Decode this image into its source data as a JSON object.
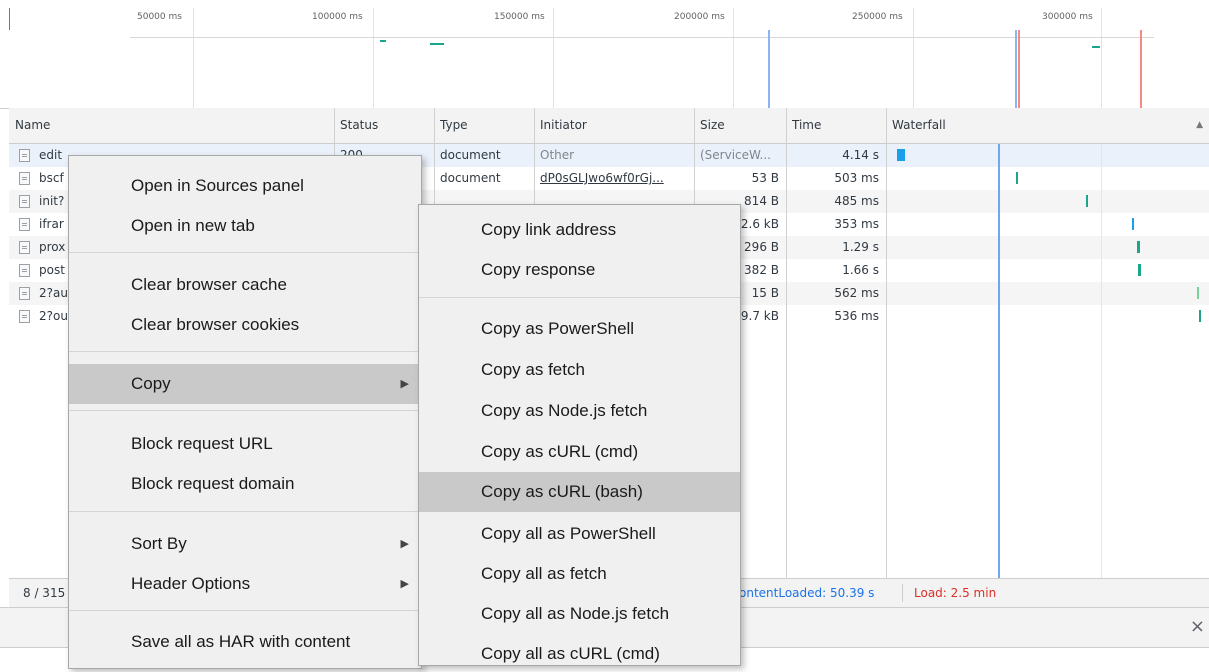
{
  "overview": {
    "ticks": [
      "50000 ms",
      "100000 ms",
      "150000 ms",
      "200000 ms",
      "250000 ms",
      "300000 ms"
    ]
  },
  "columns": {
    "name": "Name",
    "status": "Status",
    "type": "Type",
    "initiator": "Initiator",
    "size": "Size",
    "time": "Time",
    "waterfall": "Waterfall"
  },
  "rows": [
    {
      "name": "edit",
      "status": "200",
      "type": "document",
      "initiator": "Other",
      "size": "(ServiceW...",
      "time": "4.14 s"
    },
    {
      "name": "bscf",
      "status": "",
      "type": "document",
      "initiator": "dP0sGLJwo6wf0rGj...",
      "size": "53 B",
      "time": "503 ms"
    },
    {
      "name": "init?",
      "status": "",
      "type": "",
      "initiator": "",
      "size": "814 B",
      "time": "485 ms"
    },
    {
      "name": "ifrar",
      "status": "",
      "type": "",
      "initiator": "",
      "size": "2.6 kB",
      "time": "353 ms"
    },
    {
      "name": "prox",
      "status": "",
      "type": "",
      "initiator": "",
      "size": "296 B",
      "time": "1.29 s"
    },
    {
      "name": "post",
      "status": "",
      "type": "",
      "initiator": "",
      "size": "382 B",
      "time": "1.66 s"
    },
    {
      "name": "2?au",
      "status": "",
      "type": "",
      "initiator": "",
      "size": "15 B",
      "time": "562 ms"
    },
    {
      "name": "2?ou",
      "status": "",
      "type": "",
      "initiator": "",
      "size": "9.7 kB",
      "time": "536 ms"
    }
  ],
  "statusbar": {
    "requests": "8 / 315",
    "dcl": "ontentLoaded: 50.39 s",
    "load": "Load: 2.5 min"
  },
  "drawer": {
    "close": "×"
  },
  "context_menu": {
    "items": [
      "Open in Sources panel",
      "Open in new tab",
      "Clear browser cache",
      "Clear browser cookies",
      "Copy",
      "Block request URL",
      "Block request domain",
      "Sort By",
      "Header Options",
      "Save all as HAR with content"
    ]
  },
  "copy_submenu": {
    "items": [
      "Copy link address",
      "Copy response",
      "Copy as PowerShell",
      "Copy as fetch",
      "Copy as Node.js fetch",
      "Copy as cURL (cmd)",
      "Copy as cURL (bash)",
      "Copy all as PowerShell",
      "Copy all as fetch",
      "Copy all as Node.js fetch",
      "Copy all as cURL (cmd)"
    ]
  },
  "colors": {
    "dcl_blue": "#1a73e8",
    "load_red": "#d93025",
    "bar_teal": "#1aa58c",
    "highlight": "#c9c9c9"
  }
}
